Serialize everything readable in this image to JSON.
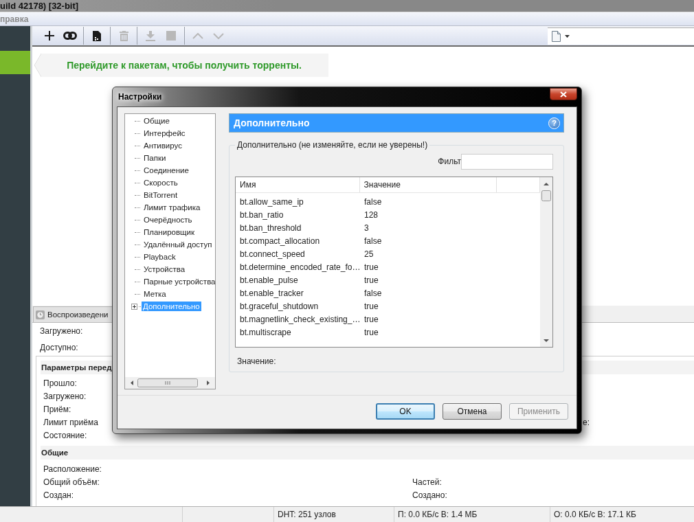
{
  "window": {
    "title": "uild 42178) [32-bit]"
  },
  "menu": [
    {
      "label": "правка"
    }
  ],
  "sidebar": {
    "items": [
      {
        "selected": true
      }
    ]
  },
  "toolbar": [
    {
      "kind": "add",
      "disabled": false
    },
    {
      "kind": "link",
      "disabled": false
    },
    {
      "kind": "file",
      "disabled": false
    },
    {
      "kind": "delete",
      "disabled": true
    },
    {
      "kind": "download",
      "disabled": true
    },
    {
      "kind": "stop",
      "disabled": true
    },
    {
      "kind": "up",
      "disabled": true
    },
    {
      "kind": "down",
      "disabled": true
    }
  ],
  "banner": {
    "text": "Перейдите к пакетам, чтобы получить торренты."
  },
  "details": {
    "tab": {
      "label": "Воспроизведени",
      "selected": true
    },
    "summary": [
      {
        "label": "Загружено:"
      },
      {
        "label": "Доступно:"
      }
    ],
    "sections": [
      {
        "title": "Параметры перед",
        "rows": [
          {
            "label": "Прошло:"
          },
          {
            "label": "Загружено:"
          },
          {
            "label": "Приём:"
          },
          {
            "label": "Лимит приёма",
            "side_label": "е:"
          },
          {
            "label": "Состояние:"
          }
        ]
      },
      {
        "title": "Общие",
        "rows": [
          {
            "label": "Расположение:"
          },
          {
            "label": "Общий объём:",
            "side_label": "Частей:"
          },
          {
            "label": "Создан:",
            "side_label": "Создано:"
          }
        ]
      }
    ]
  },
  "status_bar": [
    {
      "text": "DHT: 251 узлов"
    },
    {
      "text": "П: 0.0 КБ/с В: 1.4 МБ"
    },
    {
      "text": "О: 0.0 КБ/с В: 17.1 КБ"
    }
  ],
  "dialog": {
    "title": "Настройки",
    "tree": [
      {
        "label": "Общие",
        "selected": false,
        "expandable": false
      },
      {
        "label": "Интерфейс",
        "selected": false,
        "expandable": false
      },
      {
        "label": "Антивирус",
        "selected": false,
        "expandable": false
      },
      {
        "label": "Папки",
        "selected": false,
        "expandable": false
      },
      {
        "label": "Соединение",
        "selected": false,
        "expandable": false
      },
      {
        "label": "Скорость",
        "selected": false,
        "expandable": false
      },
      {
        "label": "BitTorrent",
        "selected": false,
        "expandable": false
      },
      {
        "label": "Лимит трафика",
        "selected": false,
        "expandable": false
      },
      {
        "label": "Очерёдность",
        "selected": false,
        "expandable": false
      },
      {
        "label": "Планировщик",
        "selected": false,
        "expandable": false
      },
      {
        "label": "Удалённый доступ",
        "selected": false,
        "expandable": false
      },
      {
        "label": "Playback",
        "selected": false,
        "expandable": false
      },
      {
        "label": "Устройства",
        "selected": false,
        "expandable": false
      },
      {
        "label": "Парные устройства",
        "selected": false,
        "expandable": false
      },
      {
        "label": "Метка",
        "selected": false,
        "expandable": false
      },
      {
        "label": "Дополнительно",
        "selected": true,
        "expandable": true
      }
    ],
    "page_title": "Дополнительно",
    "help_button": "?",
    "group_title": "Дополнительно (не изменяйте, если не уверены!)",
    "filter": {
      "label": "Фильт"
    },
    "table": {
      "columns": [
        "Имя",
        "Значение"
      ],
      "rows": [
        {
          "name": "bt.allow_same_ip",
          "value": "false"
        },
        {
          "name": "bt.ban_ratio",
          "value": "128"
        },
        {
          "name": "bt.ban_threshold",
          "value": "3"
        },
        {
          "name": "bt.compact_allocation",
          "value": "false"
        },
        {
          "name": "bt.connect_speed",
          "value": "25"
        },
        {
          "name": "bt.determine_encoded_rate_fo…",
          "value": "true"
        },
        {
          "name": "bt.enable_pulse",
          "value": "true"
        },
        {
          "name": "bt.enable_tracker",
          "value": "false"
        },
        {
          "name": "bt.graceful_shutdown",
          "value": "true"
        },
        {
          "name": "bt.magnetlink_check_existing_…",
          "value": "true"
        },
        {
          "name": "bt.multiscrape",
          "value": "true"
        }
      ]
    },
    "value_label": "Значение:",
    "buttons": [
      {
        "label": "OK",
        "default": true,
        "disabled": false
      },
      {
        "label": "Отмена",
        "default": false,
        "disabled": false
      },
      {
        "label": "Применить",
        "default": false,
        "disabled": true
      }
    ]
  }
}
